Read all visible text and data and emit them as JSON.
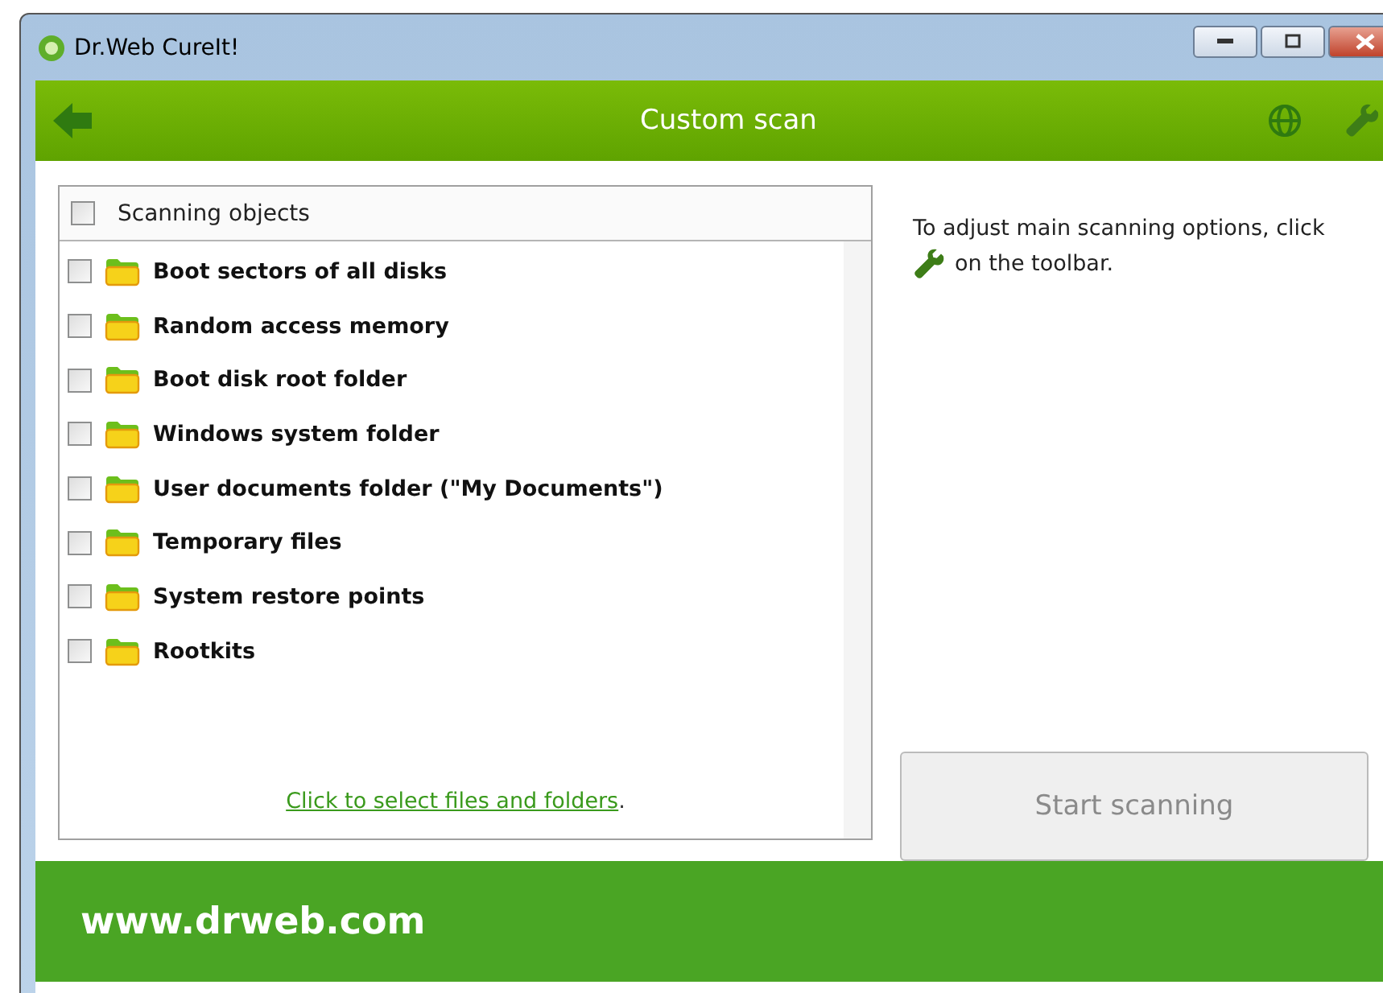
{
  "window": {
    "title": "Dr.Web CureIt!"
  },
  "toolbar": {
    "title": "Custom scan"
  },
  "objects": {
    "header": {
      "label": "Scanning objects",
      "checked": false
    },
    "items": [
      {
        "label": "Boot sectors of all disks",
        "checked": false
      },
      {
        "label": "Random access memory",
        "checked": false
      },
      {
        "label": "Boot disk root folder",
        "checked": false
      },
      {
        "label": "Windows system folder",
        "checked": false
      },
      {
        "label": "User documents folder (\"My Documents\")",
        "checked": false
      },
      {
        "label": "Temporary files",
        "checked": false
      },
      {
        "label": "System restore points",
        "checked": false
      },
      {
        "label": "Rootkits",
        "checked": false
      }
    ],
    "link": "Click to select files and folders",
    "link_suffix": "."
  },
  "hint": {
    "line_1": "To adjust main scanning options, click",
    "line_2": "on the toolbar."
  },
  "start_button": {
    "label": "Start scanning",
    "disabled": true
  },
  "footer": {
    "url": "www.drweb.com"
  }
}
